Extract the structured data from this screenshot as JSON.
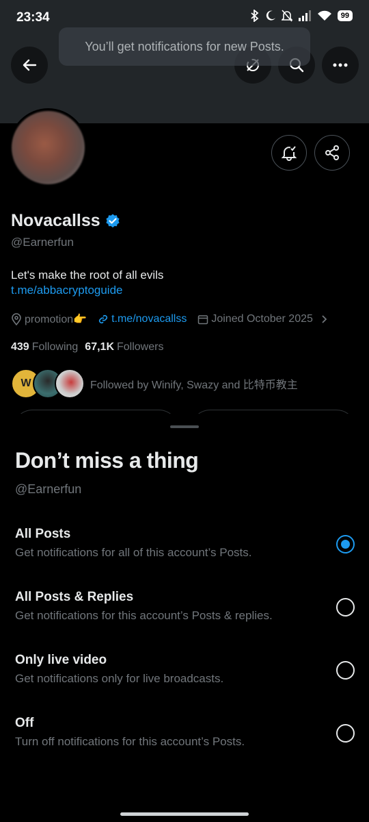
{
  "status_bar": {
    "time": "23:34",
    "battery": "99"
  },
  "toast": {
    "text": "You’ll get notifications for new Posts."
  },
  "header": {
    "back_icon": "arrow-left-icon",
    "offline_icon": "offline-icon",
    "search_icon": "search-icon",
    "more_icon": "more-horizontal-icon"
  },
  "profile": {
    "name": "Novacallss",
    "handle": "@Earnerfun",
    "bio": "Let's make the root of all evils",
    "bio_link": "t.me/abbacryptoguide",
    "location": "promotion👉",
    "website": "t.me/novacallss",
    "joined": "Joined October 2025",
    "following_count": "439",
    "following_label": "Following",
    "followers_count": "67,1K",
    "followers_label": "Followers",
    "followed_by": "Followed by Winify, Swazy and 比特币教主",
    "mini_avatar_letter": "W"
  },
  "sheet": {
    "title": "Don’t miss a thing",
    "handle": "@Earnerfun",
    "options": [
      {
        "label": "All Posts",
        "desc": "Get notifications for all of this account’s Posts.",
        "selected": true
      },
      {
        "label": "All Posts & Replies",
        "desc": "Get notifications for this account’s Posts & replies.",
        "selected": false
      },
      {
        "label": "Only live video",
        "desc": "Get notifications only for live broadcasts.",
        "selected": false
      },
      {
        "label": "Off",
        "desc": "Turn off notifications for this account’s Posts.",
        "selected": false
      }
    ]
  },
  "colors": {
    "accent": "#1d9bf0",
    "background": "#000000",
    "muted_text": "#71767b"
  }
}
